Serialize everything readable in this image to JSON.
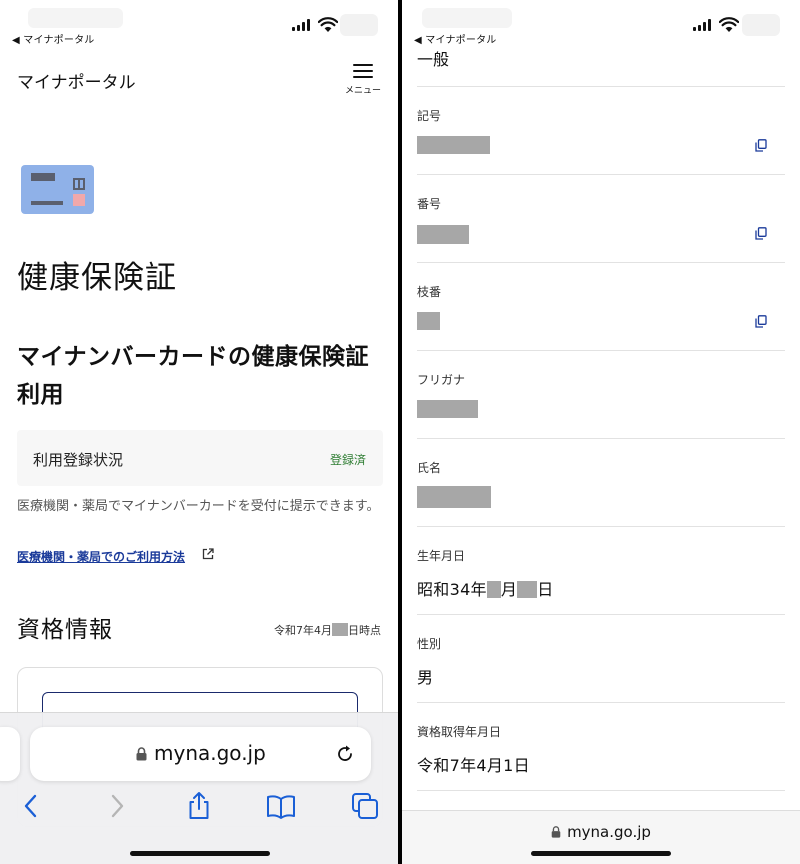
{
  "status_bar": {
    "back_app": "◀ マイナポータル"
  },
  "left": {
    "site_title": "マイナポータル",
    "menu_label": "メニュー",
    "page_title": "健康保険証",
    "section_title": "マイナンバーカードの健康保険証利用",
    "registration": {
      "label": "利用登録状況",
      "value": "登録済"
    },
    "description": "医療機関・薬局でマイナンバーカードを受付に提示できます。",
    "usage_link": "医療機関・薬局でのご利用方法",
    "qualification_title": "資格情報",
    "as_of_prefix": "令和7年4月",
    "as_of_suffix": "日時点",
    "browser": {
      "url": "myna.go.jp"
    }
  },
  "right": {
    "top_value": "一般",
    "rows": [
      {
        "label": "記号"
      },
      {
        "label": "番号"
      },
      {
        "label": "枝番"
      },
      {
        "label": "フリガナ"
      },
      {
        "label": "氏名"
      },
      {
        "label": "生年月日",
        "value_parts": [
          "昭和34年",
          "月",
          "日"
        ]
      },
      {
        "label": "性別",
        "value": "男"
      },
      {
        "label": "資格取得年月日",
        "value": "令和7年4月1日"
      }
    ],
    "browser": {
      "url": "myna.go.jp"
    }
  }
}
